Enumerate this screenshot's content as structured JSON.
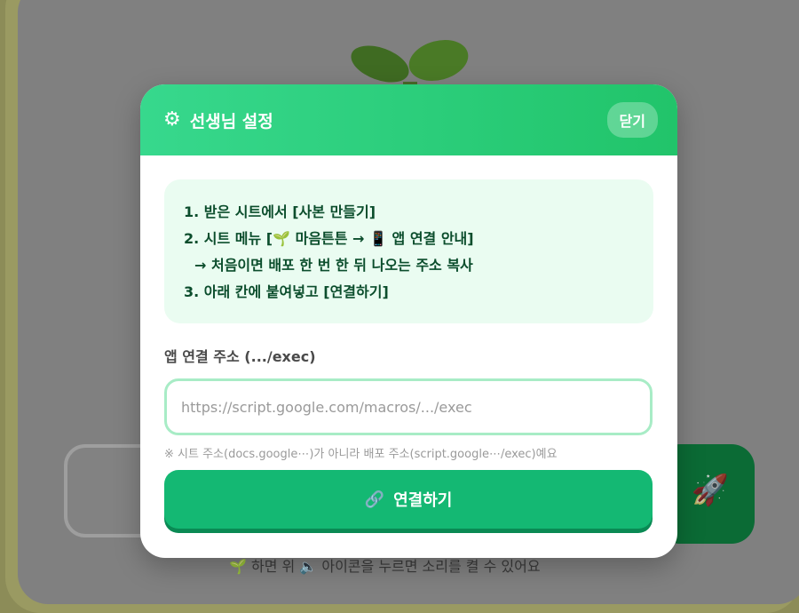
{
  "modal": {
    "title": "선생님 설정",
    "close_label": "닫기",
    "icon": "gear-icon",
    "instructions": [
      "1. 받은 시트에서 [사본 만들기]",
      "2. 시트 메뉴 [🌱 마음튼튼 → 📱 앱 연결 안내]",
      "→ 처음이면 배포 한 번 한 뒤 나오는 주소 복사",
      "3. 아래 칸에 붙여넣고 [연결하기]"
    ],
    "field_label": "앱 연결 주소 (.../exec)",
    "input_placeholder": "https://script.google.com/macros/.../exec",
    "input_value": "",
    "note": "※ 시트 주소(docs.google⋯)가 아니라 배포 주소(script.google⋯/exec)예요",
    "connect_label": "연결하기",
    "connect_icon": "link-icon"
  },
  "background": {
    "hint_text": "🌱 하면 위 🔈 아이콘을 누르면 소리를 켤 수 있어요",
    "action_icon": "rocket-icon"
  },
  "colors": {
    "header_start": "#37d88d",
    "header_end": "#21c46a",
    "info_bg": "#eafcf1",
    "info_text": "#0b4d2c",
    "input_border": "#a8ecc6",
    "button": "#14b873",
    "overlay": "#808080"
  }
}
